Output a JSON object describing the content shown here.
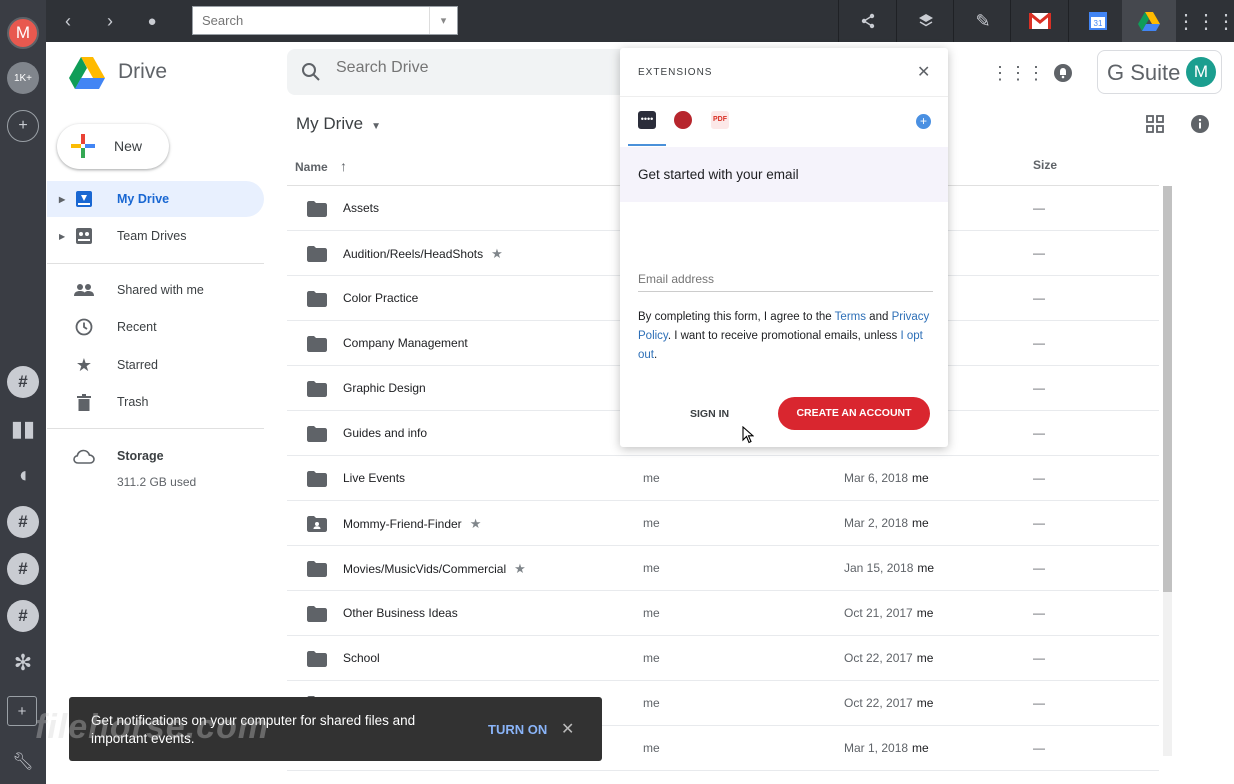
{
  "browser": {
    "search_placeholder": "Search",
    "dock_badge": "1K+"
  },
  "header": {
    "app_name": "Drive",
    "search_placeholder": "Search Drive",
    "gsuite_label": "G Suite",
    "avatar_letter": "M"
  },
  "sidebar": {
    "new_label": "New",
    "items": [
      {
        "label": "My Drive"
      },
      {
        "label": "Team Drives"
      },
      {
        "label": "Shared with me"
      },
      {
        "label": "Recent"
      },
      {
        "label": "Starred"
      },
      {
        "label": "Trash"
      },
      {
        "label": "Storage"
      }
    ],
    "storage_used": "311.2 GB used"
  },
  "main": {
    "title": "My Drive",
    "columns": {
      "name": "Name",
      "size": "Size"
    },
    "rows": [
      {
        "name": "Assets",
        "owner": "",
        "modified": "",
        "by": "",
        "size": "—"
      },
      {
        "name": "Audition/Reels/HeadShots",
        "owner": "",
        "modified": "",
        "by": "",
        "size": "—"
      },
      {
        "name": "Color Practice",
        "owner": "",
        "modified": "",
        "by": "",
        "size": "—"
      },
      {
        "name": "Company Management",
        "owner": "",
        "modified": "",
        "by": "",
        "size": "—"
      },
      {
        "name": "Graphic Design",
        "owner": "",
        "modified": "",
        "by": "",
        "size": "—"
      },
      {
        "name": "Guides and info",
        "owner": "",
        "modified": "",
        "by": "",
        "size": "—"
      },
      {
        "name": "Live Events",
        "owner": "me",
        "modified": "Mar 6, 2018",
        "by": "me",
        "size": "—"
      },
      {
        "name": "Mommy-Friend-Finder",
        "owner": "me",
        "modified": "Mar 2, 2018",
        "by": "me",
        "size": "—"
      },
      {
        "name": "Movies/MusicVids/Commercial",
        "owner": "me",
        "modified": "Jan 15, 2018",
        "by": "me",
        "size": "—"
      },
      {
        "name": "Other Business Ideas",
        "owner": "me",
        "modified": "Oct 21, 2017",
        "by": "me",
        "size": "—"
      },
      {
        "name": "School",
        "owner": "me",
        "modified": "Oct 22, 2017",
        "by": "me",
        "size": "—"
      },
      {
        "name": "",
        "owner": "me",
        "modified": "Oct 22, 2017",
        "by": "me",
        "size": "—"
      },
      {
        "name": "",
        "owner": "me",
        "modified": "Mar 1, 2018",
        "by": "me",
        "size": "—"
      }
    ]
  },
  "popup": {
    "title": "EXTENSIONS",
    "band_text": "Get started with your email",
    "email_placeholder": "Email address",
    "legal_1": "By completing this form, I agree to the ",
    "terms": "Terms",
    "legal_2": " and ",
    "privacy": "Privacy Policy",
    "legal_3": ". I want to receive promotional emails, unless ",
    "optout": "I opt out",
    "legal_4": ".",
    "sign_in": "SIGN IN",
    "create": "CREATE AN ACCOUNT"
  },
  "toast": {
    "message": "Get notifications on your computer for shared files and important events.",
    "action": "TURN ON"
  },
  "watermark": "filehorse.com",
  "colors": {
    "accent": "#1967d2",
    "create_button": "#d9262f",
    "toast_bg": "#323232"
  }
}
